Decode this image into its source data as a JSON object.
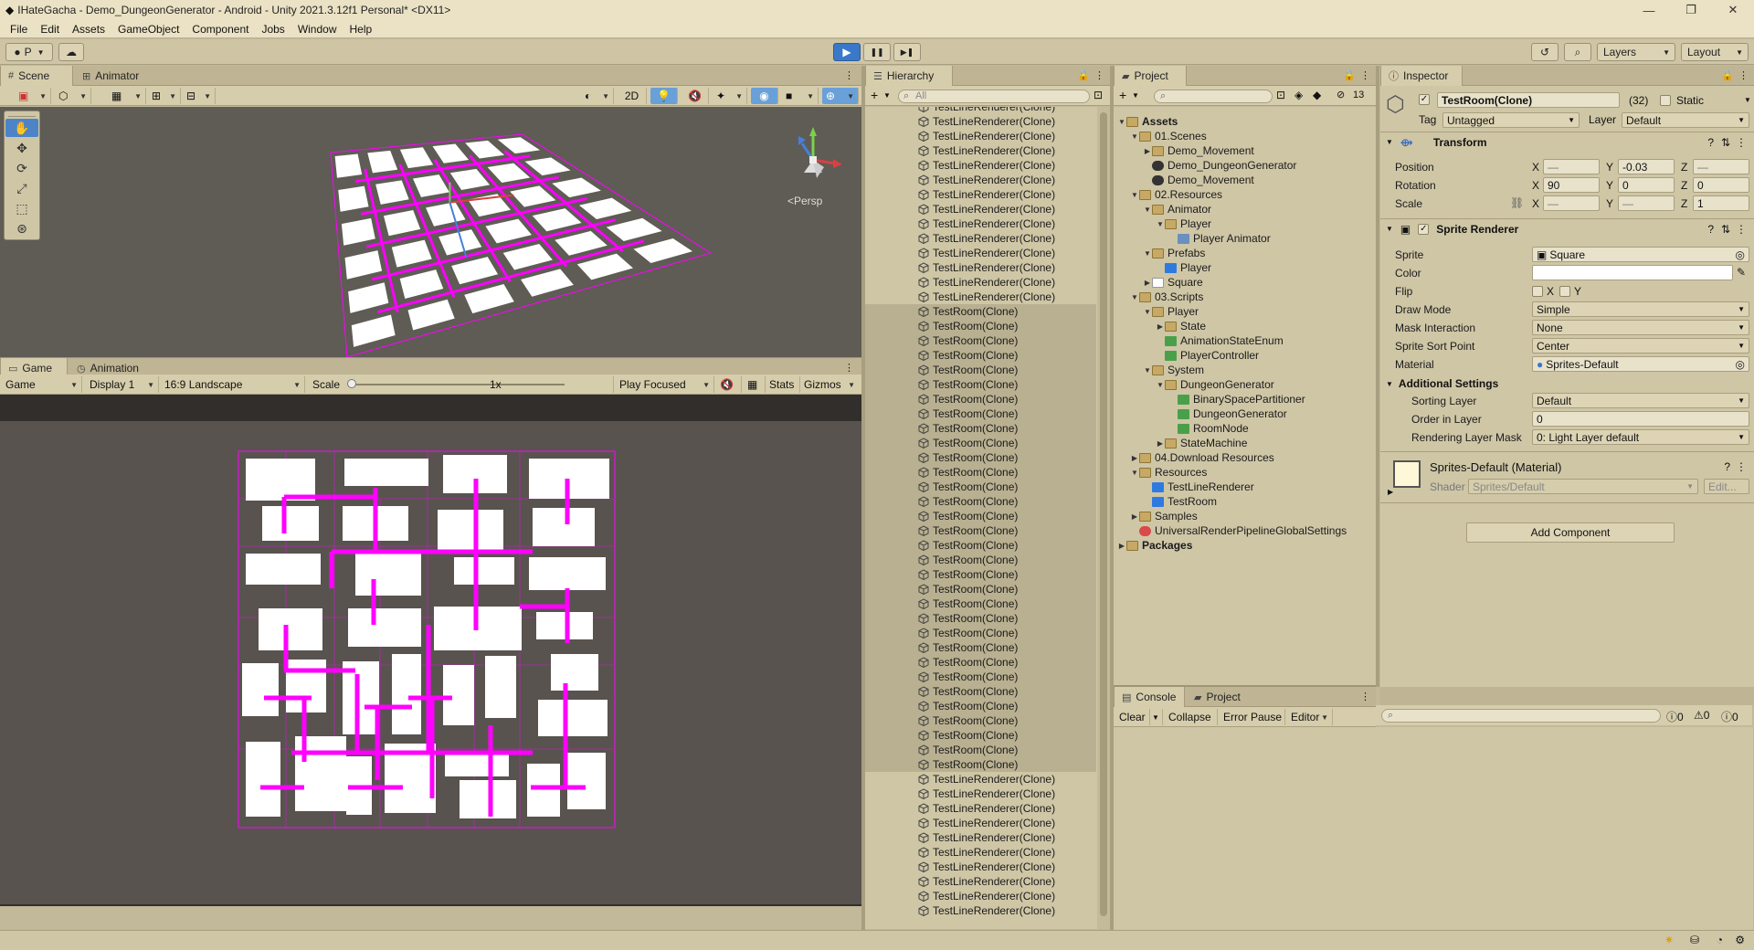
{
  "window": {
    "title": "IHateGacha - Demo_DungeonGenerator - Android - Unity 2021.3.12f1 Personal* <DX11>",
    "controls": [
      "—",
      "❐",
      "✕"
    ]
  },
  "menu": [
    "File",
    "Edit",
    "Assets",
    "GameObject",
    "Component",
    "Jobs",
    "Window",
    "Help"
  ],
  "toolbar": {
    "account": "P",
    "play_icon": "▶",
    "pause_icon": "❚❚",
    "step_icon": "▶❚",
    "layers": "Layers",
    "layout": "Layout"
  },
  "scene": {
    "tabs": [
      "Scene",
      "Animator"
    ],
    "mode_2d": "2D",
    "persp_label": "<Persp"
  },
  "game": {
    "tabs": [
      "Game",
      "Animation"
    ],
    "display_mode": "Game",
    "display": "Display 1",
    "aspect": "16:9 Landscape",
    "scale_label": "Scale",
    "scale_value": "1x",
    "play_focused": "Play Focused",
    "stats": "Stats",
    "gizmos": "Gizmos"
  },
  "hierarchy": {
    "tab": "Hierarchy",
    "search_placeholder": "All",
    "rows": [
      {
        "name": "TestLineRenderer(Clone)",
        "sel": false
      },
      {
        "name": "TestLineRenderer(Clone)",
        "sel": false
      },
      {
        "name": "TestLineRenderer(Clone)",
        "sel": false
      },
      {
        "name": "TestLineRenderer(Clone)",
        "sel": false
      },
      {
        "name": "TestLineRenderer(Clone)",
        "sel": false
      },
      {
        "name": "TestLineRenderer(Clone)",
        "sel": false
      },
      {
        "name": "TestLineRenderer(Clone)",
        "sel": false
      },
      {
        "name": "TestLineRenderer(Clone)",
        "sel": false
      },
      {
        "name": "TestLineRenderer(Clone)",
        "sel": false
      },
      {
        "name": "TestLineRenderer(Clone)",
        "sel": false
      },
      {
        "name": "TestLineRenderer(Clone)",
        "sel": false
      },
      {
        "name": "TestLineRenderer(Clone)",
        "sel": false
      },
      {
        "name": "TestLineRenderer(Clone)",
        "sel": false
      },
      {
        "name": "TestLineRenderer(Clone)",
        "sel": false
      },
      {
        "name": "TestRoom(Clone)",
        "sel": true
      },
      {
        "name": "TestRoom(Clone)",
        "sel": true
      },
      {
        "name": "TestRoom(Clone)",
        "sel": true
      },
      {
        "name": "TestRoom(Clone)",
        "sel": true
      },
      {
        "name": "TestRoom(Clone)",
        "sel": true
      },
      {
        "name": "TestRoom(Clone)",
        "sel": true
      },
      {
        "name": "TestRoom(Clone)",
        "sel": true
      },
      {
        "name": "TestRoom(Clone)",
        "sel": true
      },
      {
        "name": "TestRoom(Clone)",
        "sel": true
      },
      {
        "name": "TestRoom(Clone)",
        "sel": true
      },
      {
        "name": "TestRoom(Clone)",
        "sel": true
      },
      {
        "name": "TestRoom(Clone)",
        "sel": true
      },
      {
        "name": "TestRoom(Clone)",
        "sel": true
      },
      {
        "name": "TestRoom(Clone)",
        "sel": true
      },
      {
        "name": "TestRoom(Clone)",
        "sel": true
      },
      {
        "name": "TestRoom(Clone)",
        "sel": true
      },
      {
        "name": "TestRoom(Clone)",
        "sel": true
      },
      {
        "name": "TestRoom(Clone)",
        "sel": true
      },
      {
        "name": "TestRoom(Clone)",
        "sel": true
      },
      {
        "name": "TestRoom(Clone)",
        "sel": true
      },
      {
        "name": "TestRoom(Clone)",
        "sel": true
      },
      {
        "name": "TestRoom(Clone)",
        "sel": true
      },
      {
        "name": "TestRoom(Clone)",
        "sel": true
      },
      {
        "name": "TestRoom(Clone)",
        "sel": true
      },
      {
        "name": "TestRoom(Clone)",
        "sel": true
      },
      {
        "name": "TestRoom(Clone)",
        "sel": true
      },
      {
        "name": "TestRoom(Clone)",
        "sel": true
      },
      {
        "name": "TestRoom(Clone)",
        "sel": true
      },
      {
        "name": "TestRoom(Clone)",
        "sel": true
      },
      {
        "name": "TestRoom(Clone)",
        "sel": true
      },
      {
        "name": "TestRoom(Clone)",
        "sel": true
      },
      {
        "name": "TestRoom(Clone)",
        "sel": true
      },
      {
        "name": "TestLineRenderer(Clone)",
        "sel": false
      },
      {
        "name": "TestLineRenderer(Clone)",
        "sel": false
      },
      {
        "name": "TestLineRenderer(Clone)",
        "sel": false
      },
      {
        "name": "TestLineRenderer(Clone)",
        "sel": false
      },
      {
        "name": "TestLineRenderer(Clone)",
        "sel": false
      },
      {
        "name": "TestLineRenderer(Clone)",
        "sel": false
      },
      {
        "name": "TestLineRenderer(Clone)",
        "sel": false
      },
      {
        "name": "TestLineRenderer(Clone)",
        "sel": false
      },
      {
        "name": "TestLineRenderer(Clone)",
        "sel": false
      },
      {
        "name": "TestLineRenderer(Clone)",
        "sel": false
      }
    ]
  },
  "project": {
    "tab": "Project",
    "hidden_count": "13",
    "tree": [
      {
        "label": "Assets",
        "depth": 0,
        "fold": "▼",
        "icon": "folder",
        "bold": true
      },
      {
        "label": "01.Scenes",
        "depth": 1,
        "fold": "▼",
        "icon": "folder"
      },
      {
        "label": "Demo_Movement",
        "depth": 2,
        "fold": "▶",
        "icon": "folder"
      },
      {
        "label": "Demo_DungeonGenerator",
        "depth": 2,
        "fold": "",
        "icon": "unity"
      },
      {
        "label": "Demo_Movement",
        "depth": 2,
        "fold": "",
        "icon": "unity"
      },
      {
        "label": "02.Resources",
        "depth": 1,
        "fold": "▼",
        "icon": "folder"
      },
      {
        "label": "Animator",
        "depth": 2,
        "fold": "▼",
        "icon": "folder"
      },
      {
        "label": "Player",
        "depth": 3,
        "fold": "▼",
        "icon": "folder"
      },
      {
        "label": "Player Animator",
        "depth": 4,
        "fold": "",
        "icon": "anim"
      },
      {
        "label": "Prefabs",
        "depth": 2,
        "fold": "▼",
        "icon": "folder"
      },
      {
        "label": "Player",
        "depth": 3,
        "fold": "",
        "icon": "prefab"
      },
      {
        "label": "Square",
        "depth": 2,
        "fold": "▶",
        "icon": "white"
      },
      {
        "label": "03.Scripts",
        "depth": 1,
        "fold": "▼",
        "icon": "folder"
      },
      {
        "label": "Player",
        "depth": 2,
        "fold": "▼",
        "icon": "folder"
      },
      {
        "label": "State",
        "depth": 3,
        "fold": "▶",
        "icon": "folder"
      },
      {
        "label": "AnimationStateEnum",
        "depth": 3,
        "fold": "",
        "icon": "script"
      },
      {
        "label": "PlayerController",
        "depth": 3,
        "fold": "",
        "icon": "script"
      },
      {
        "label": "System",
        "depth": 2,
        "fold": "▼",
        "icon": "folder"
      },
      {
        "label": "DungeonGenerator",
        "depth": 3,
        "fold": "▼",
        "icon": "folder"
      },
      {
        "label": "BinarySpacePartitioner",
        "depth": 4,
        "fold": "",
        "icon": "script"
      },
      {
        "label": "DungeonGenerator",
        "depth": 4,
        "fold": "",
        "icon": "script"
      },
      {
        "label": "RoomNode",
        "depth": 4,
        "fold": "",
        "icon": "script"
      },
      {
        "label": "StateMachine",
        "depth": 3,
        "fold": "▶",
        "icon": "folder"
      },
      {
        "label": "04.Download Resources",
        "depth": 1,
        "fold": "▶",
        "icon": "folder"
      },
      {
        "label": "Resources",
        "depth": 1,
        "fold": "▼",
        "icon": "folder"
      },
      {
        "label": "TestLineRenderer",
        "depth": 2,
        "fold": "",
        "icon": "prefab"
      },
      {
        "label": "TestRoom",
        "depth": 2,
        "fold": "",
        "icon": "prefab"
      },
      {
        "label": "Samples",
        "depth": 1,
        "fold": "▶",
        "icon": "folder"
      },
      {
        "label": "UniversalRenderPipelineGlobalSettings",
        "depth": 1,
        "fold": "",
        "icon": "settings"
      },
      {
        "label": "Packages",
        "depth": 0,
        "fold": "▶",
        "icon": "folder",
        "bold": true
      }
    ]
  },
  "console": {
    "tabs": [
      "Console",
      "Project"
    ],
    "clear": "Clear",
    "collapse": "Collapse",
    "error_pause": "Error Pause",
    "editor": "Editor",
    "counts": [
      "0",
      "0",
      "0"
    ]
  },
  "inspector": {
    "tab": "Inspector",
    "object_name": "TestRoom(Clone)",
    "count": "(32)",
    "static_label": "Static",
    "tag_label": "Tag",
    "tag_value": "Untagged",
    "layer_label": "Layer",
    "layer_value": "Default",
    "transform": {
      "title": "Transform",
      "position_label": "Position",
      "rotation_label": "Rotation",
      "scale_label": "Scale",
      "pos": {
        "x": "—",
        "y": "-0.03",
        "z": "—"
      },
      "rot": {
        "x": "90",
        "y": "0",
        "z": "0"
      },
      "scl": {
        "x": "—",
        "y": "—",
        "z": "1"
      }
    },
    "sprite_renderer": {
      "title": "Sprite Renderer",
      "sprite_label": "Sprite",
      "sprite_value": "Square",
      "color_label": "Color",
      "color_value": "#ffffff",
      "flip_label": "Flip",
      "flip_x": "X",
      "flip_y": "Y",
      "draw_mode_label": "Draw Mode",
      "draw_mode_value": "Simple",
      "mask_label": "Mask Interaction",
      "mask_value": "None",
      "sort_point_label": "Sprite Sort Point",
      "sort_point_value": "Center",
      "material_label": "Material",
      "material_value": "Sprites-Default",
      "additional_title": "Additional Settings",
      "sorting_layer_label": "Sorting Layer",
      "sorting_layer_value": "Default",
      "order_label": "Order in Layer",
      "order_value": "0",
      "rlm_label": "Rendering Layer Mask",
      "rlm_value": "0: Light Layer default"
    },
    "material": {
      "title": "Sprites-Default (Material)",
      "shader_label": "Shader",
      "shader_value": "Sprites/Default",
      "edit": "Edit..."
    },
    "add_component": "Add Component"
  },
  "colors": {
    "accent": "#3a79c9",
    "corridor": "#ff00ff",
    "room": "#ffffff"
  }
}
